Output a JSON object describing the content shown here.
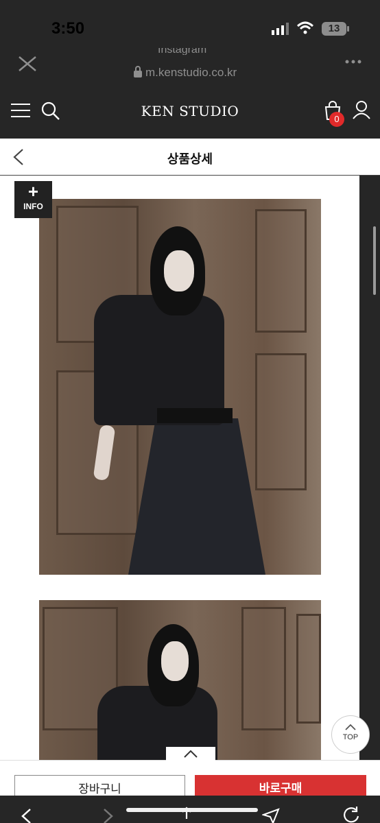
{
  "status": {
    "time": "3:50",
    "battery": "13"
  },
  "browser": {
    "site_title": "Instagram",
    "url": "m.kenstudio.co.kr"
  },
  "header": {
    "brand": "KEN STUDIO",
    "cart_count": "0"
  },
  "subheader": {
    "title": "상품상세"
  },
  "info_button": {
    "label": "INFO"
  },
  "top_button": {
    "label": "TOP"
  },
  "actions": {
    "cart_label": "장바구니",
    "buy_label": "바로구매"
  },
  "colors": {
    "accent": "#d83232",
    "dark": "#262626"
  }
}
